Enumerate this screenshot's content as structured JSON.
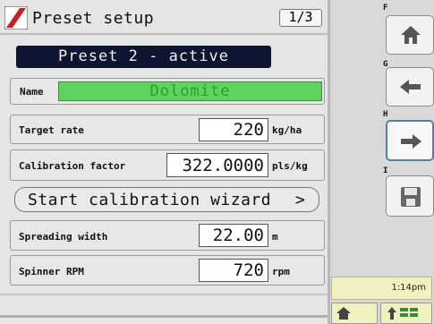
{
  "header": {
    "title": "Preset setup",
    "page_indicator": "1/3"
  },
  "status_bar": {
    "text": "Preset 2 - active"
  },
  "fields": {
    "name": {
      "label": "Name",
      "value": "Dolomite"
    },
    "target_rate": {
      "label": "Target rate",
      "value": "220",
      "unit": "kg/ha"
    },
    "calibration_factor": {
      "label": "Calibration factor",
      "value": "322.0000",
      "unit": "pls/kg"
    },
    "spreading_width": {
      "label": "Spreading width",
      "value": "22.00",
      "unit": "m"
    },
    "spinner_rpm": {
      "label": "Spinner RPM",
      "value": "720",
      "unit": "rpm"
    }
  },
  "wizard_button": {
    "label": "Start calibration wizard",
    "arrow": ">"
  },
  "softkeys": [
    {
      "key": "F",
      "icon": "home-icon"
    },
    {
      "key": "G",
      "icon": "arrow-left-icon"
    },
    {
      "key": "H",
      "icon": "arrow-right-icon"
    },
    {
      "key": "I",
      "icon": "save-icon"
    }
  ],
  "clock": {
    "time": "1:14pm"
  },
  "bottom_nav": {
    "home": "home-icon",
    "menu": "grid-menu-icon"
  },
  "colors": {
    "name_field": "#5fd35f",
    "active_bar": "#0f1430",
    "clock_bg": "#f1f0c0",
    "logo": "#c8202a"
  }
}
